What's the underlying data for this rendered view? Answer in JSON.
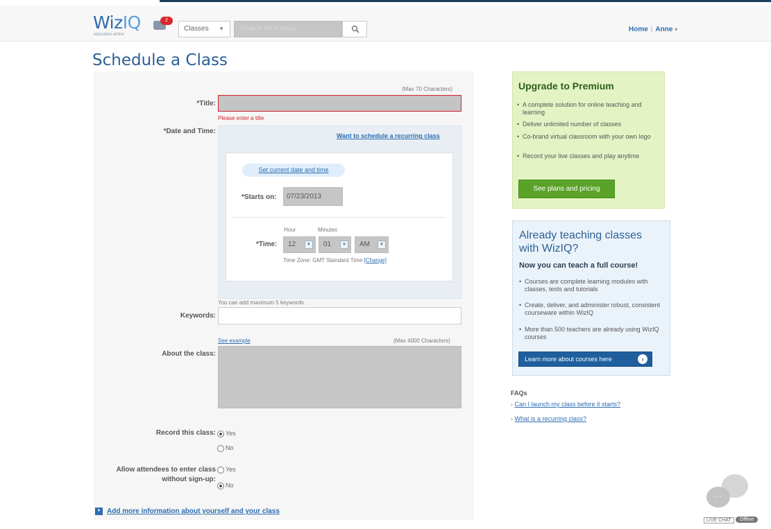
{
  "header": {
    "logo_main": "Wiz",
    "logo_accent": "IQ",
    "logo_tagline": "education.online",
    "notifications_count": "2",
    "type_select_value": "Classes",
    "search_placeholder": "Search for a class",
    "nav_home": "Home",
    "nav_user": "Anne"
  },
  "page": {
    "title": "Schedule a Class"
  },
  "form": {
    "title_counter": "(Max 70 Characters)",
    "title_label": "*Title:",
    "title_error": "Please enter a title",
    "datetime_label": "*Date and Time:",
    "recurring_link": "Want to schedule a recurring class",
    "set_current_link": "Set current date and time",
    "starts_on_label": "*Starts on:",
    "starts_on_value": "07/23/2013",
    "hour_label": "Hour",
    "minutes_label": "Minutes",
    "time_label": "*Time:",
    "hour_value": "12",
    "minute_value": "01",
    "ampm_value": "AM",
    "timezone_text": "Time Zone: GMT Standard Time",
    "change_link": "[Change]",
    "keywords_hint": "You can add maximum 5 keywords.",
    "keywords_label": "Keywords:",
    "see_example_link": "See example",
    "about_counter": "(Max 4000 Characters)",
    "about_label": "About the class:",
    "record_label": "Record this class:",
    "record_yes": "Yes",
    "record_no": "No",
    "signup_label_1": "Allow attendees to enter class",
    "signup_label_2": "without sign-up:",
    "signup_yes": "Yes",
    "signup_no": "No",
    "more_info_link": "Add more information about yourself and your class"
  },
  "premium": {
    "heading": "Upgrade to Premium",
    "bullets": [
      "A complete solution for online teaching and learning",
      "Deliver unlimited number of classes",
      "Co-brand virtual classroom with your own logo",
      "Record your live classes and play anytime"
    ],
    "button": "See plans and pricing"
  },
  "courses": {
    "heading": "Already teaching classes with WizIQ?",
    "subheading": "Now you can teach a full course!",
    "bullets": [
      "Courses are complete learning modules with classes, tests and tutorials",
      "Create, deliver, and administer robust, consistent courseware within WizIQ",
      "More than 500 teachers are already using WizIQ courses"
    ],
    "button": "Learn more about courses here"
  },
  "faqs": {
    "heading": "FAQs",
    "items": [
      "Can I launch my class before it starts?",
      "What is a recurring class?"
    ]
  },
  "chat": {
    "label": "LIVE CHAT",
    "status": "Offline"
  },
  "colors": {
    "brand_blue": "#2d6db0",
    "error_red": "#d2232a",
    "premium_green": "#5aa328",
    "dark_blue_button": "#1f5f9e"
  }
}
